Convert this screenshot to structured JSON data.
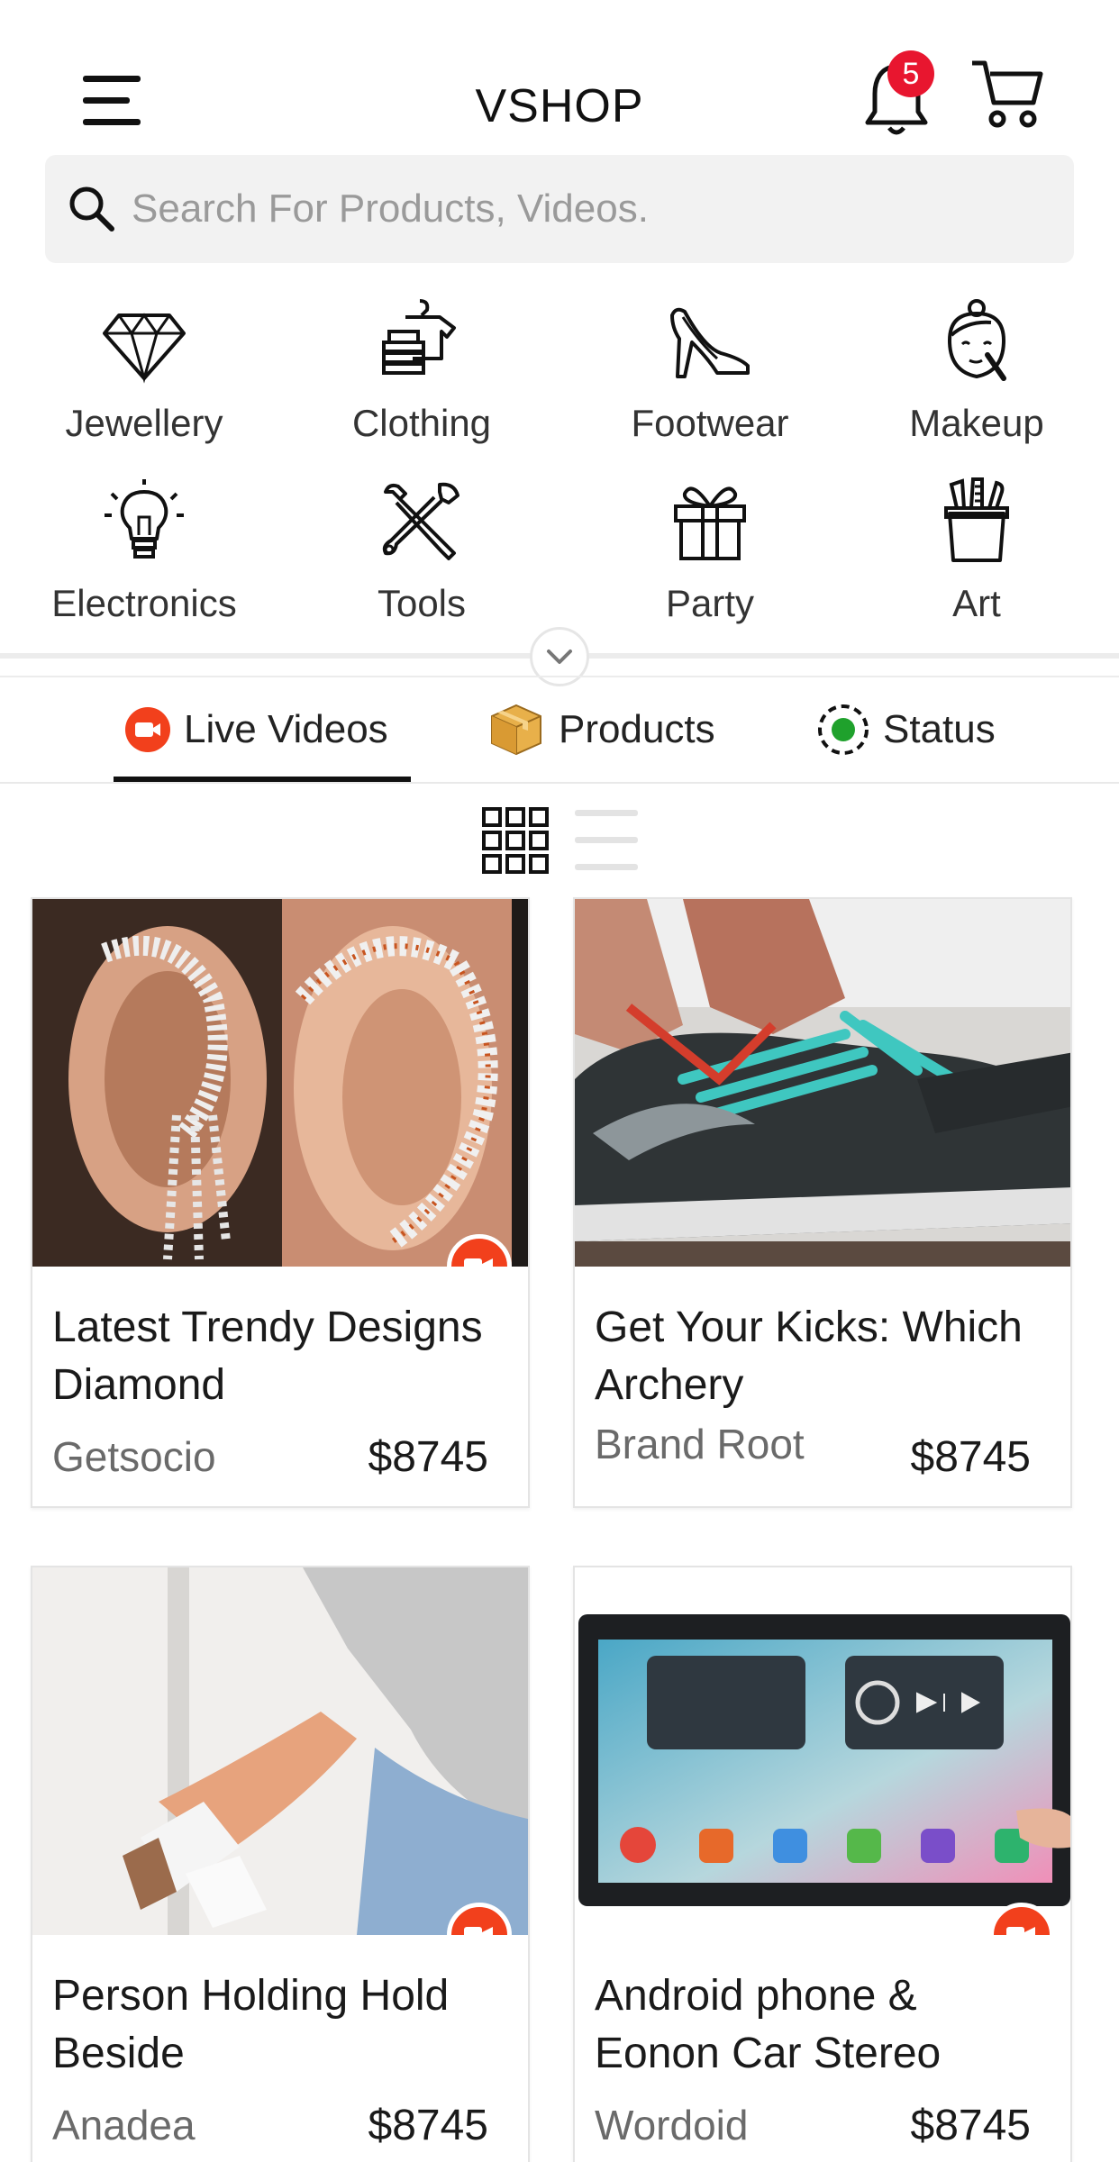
{
  "header": {
    "title": "VSHOP",
    "notification_count": "5"
  },
  "search": {
    "placeholder": "Search For Products, Videos."
  },
  "categories": [
    {
      "label": "Jewellery",
      "icon": "diamond-icon"
    },
    {
      "label": "Clothing",
      "icon": "clothes-rack-icon"
    },
    {
      "label": "Footwear",
      "icon": "high-heel-icon"
    },
    {
      "label": "Makeup",
      "icon": "makeup-face-icon"
    },
    {
      "label": "Electronics",
      "icon": "light-bulb-icon"
    },
    {
      "label": "Tools",
      "icon": "wrench-screwdriver-icon"
    },
    {
      "label": "Party",
      "icon": "gift-icon"
    },
    {
      "label": "Art",
      "icon": "brush-pot-icon"
    }
  ],
  "tabs": [
    {
      "label": "Live Videos",
      "icon": "video-camera-icon",
      "active": true
    },
    {
      "label": "Products",
      "icon": "box-icon",
      "active": false
    },
    {
      "label": "Status",
      "icon": "status-ring-icon",
      "active": false
    }
  ],
  "view": {
    "grid_selected": true
  },
  "products": [
    {
      "title": "Latest Trendy Designs Diamond",
      "seller": "Getsocio",
      "price": "$8745",
      "live": true
    },
    {
      "title": "Get Your Kicks:  Which Archery",
      "seller": "Brand Root",
      "price": "$8745",
      "live": false
    },
    {
      "title": "Person Holding Hold Beside",
      "seller": "Anadea",
      "price": "$8745",
      "live": true
    },
    {
      "title": "Android phone & Eonon Car Stereo",
      "seller": "Wordoid",
      "price": "$8745",
      "live": true
    }
  ],
  "colors": {
    "accent": "#f2401c",
    "badge": "#e8162f",
    "status_green": "#1fa12c"
  }
}
